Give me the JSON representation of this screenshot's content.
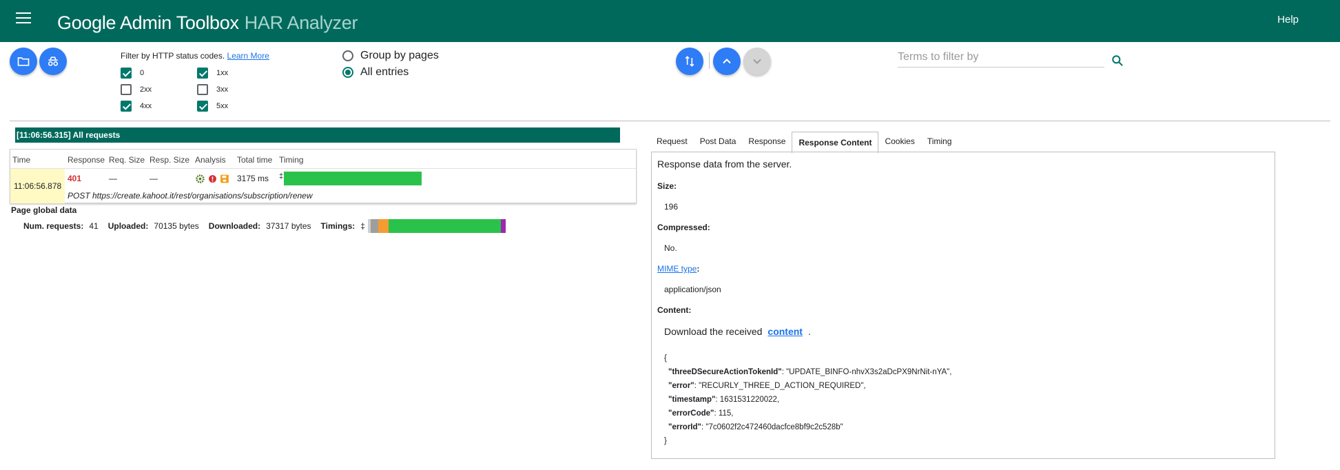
{
  "header": {
    "product": "Google Admin Toolbox",
    "tool": "HAR Analyzer",
    "help": "Help"
  },
  "filters": {
    "label": "Filter by HTTP status codes.",
    "learn_more": "Learn More",
    "codes": [
      {
        "label": "0",
        "checked": true
      },
      {
        "label": "1xx",
        "checked": true
      },
      {
        "label": "2xx",
        "checked": false
      },
      {
        "label": "3xx",
        "checked": false
      },
      {
        "label": "4xx",
        "checked": true
      },
      {
        "label": "5xx",
        "checked": true
      }
    ]
  },
  "grouping": {
    "group_by_pages": "Group by pages",
    "all_entries": "All entries",
    "selected": "all_entries"
  },
  "search": {
    "placeholder": "Terms to filter by"
  },
  "page_group": {
    "title": "[11:06:56.315] All requests"
  },
  "table": {
    "headers": [
      "Time",
      "Response",
      "Req. Size",
      "Resp. Size",
      "Analysis",
      "Total time",
      "Timing"
    ],
    "row": {
      "time": "11:06:56.878",
      "response": "401",
      "req_size": "—",
      "resp_size": "—",
      "total_time": "3175 ms",
      "timing_mark": "‡",
      "url": "POST https://create.kahoot.it/rest/organisations/subscription/renew"
    }
  },
  "global": {
    "title": "Page global data",
    "num_requests_label": "Num. requests:",
    "num_requests": "41",
    "uploaded_label": "Uploaded:",
    "uploaded": "70135 bytes",
    "downloaded_label": "Downloaded:",
    "downloaded": "37317 bytes",
    "timings_label": "Timings:",
    "timings_mark": "‡"
  },
  "tabs": [
    {
      "label": "Request",
      "active": false
    },
    {
      "label": "Post Data",
      "active": false
    },
    {
      "label": "Response",
      "active": false
    },
    {
      "label": "Response Content",
      "active": true
    },
    {
      "label": "Cookies",
      "active": false
    },
    {
      "label": "Timing",
      "active": false
    }
  ],
  "response_content": {
    "description": "Response data from the server.",
    "size_label": "Size:",
    "size": "196",
    "compressed_label": "Compressed:",
    "compressed": "No.",
    "mime_link": "MIME type",
    "mime_suffix": ":",
    "mime": "application/json",
    "content_label": "Content:",
    "download_prefix": "Download the received",
    "download_link": "content",
    "download_suffix": ".",
    "json_open": "{",
    "json_close": "}",
    "json_lines": [
      {
        "key": "\"threeDSecureActionTokenId\"",
        "value": ": \"UPDATE_BINFO-nhvX3s2aDcPX9NrNit-nYA\","
      },
      {
        "key": "\"error\"",
        "value": ": \"RECURLY_THREE_D_ACTION_REQUIRED\","
      },
      {
        "key": "\"timestamp\"",
        "value": ": 1631531220022,"
      },
      {
        "key": "\"errorCode\"",
        "value": ": 115,"
      },
      {
        "key": "\"errorId\"",
        "value": ": \"7c0602f2c472460dacfce8bf9c2c528b\""
      }
    ]
  },
  "colors": {
    "header_bg": "#00695c",
    "accent_blue": "#2e7cf6",
    "timing_green": "#2bc24b",
    "timing_gray": "#9e9e9e",
    "timing_orange": "#f39c34",
    "timing_purple": "#9c27b0",
    "error_red": "#d32f2f"
  }
}
